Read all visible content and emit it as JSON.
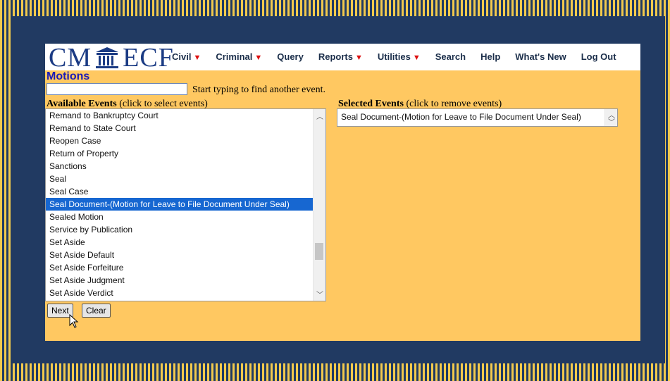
{
  "logo": {
    "left": "CM",
    "right": "ECF"
  },
  "nav": [
    {
      "label": "Civil",
      "dropdown": true
    },
    {
      "label": "Criminal",
      "dropdown": true
    },
    {
      "label": "Query",
      "dropdown": false
    },
    {
      "label": "Reports",
      "dropdown": true
    },
    {
      "label": "Utilities",
      "dropdown": true
    },
    {
      "label": "Search",
      "dropdown": false
    },
    {
      "label": "Help",
      "dropdown": false
    },
    {
      "label": "What's New",
      "dropdown": false
    },
    {
      "label": "Log Out",
      "dropdown": false
    }
  ],
  "page": {
    "title": "Motions",
    "search_value": "",
    "search_hint": "Start typing to find another event.",
    "available_label_bold": "Available Events",
    "available_label_rest": " (click to select events)",
    "selected_label_bold": "Selected Events",
    "selected_label_rest": " (click to remove events)"
  },
  "available_events": [
    "Remand to Bankruptcy Court",
    "Remand to State Court",
    "Reopen Case",
    "Return of Property",
    "Sanctions",
    "Seal",
    "Seal Case",
    "Seal Document-(Motion for Leave to File Document Under Seal)",
    "Sealed Motion",
    "Service by Publication",
    "Set Aside",
    "Set Aside Default",
    "Set Aside Forfeiture",
    "Set Aside Judgment",
    "Set Aside Verdict"
  ],
  "available_selected_index": 7,
  "selected_events": [
    "Seal Document-(Motion for Leave to File Document Under Seal)"
  ],
  "buttons": {
    "next": "Next",
    "clear": "Clear"
  },
  "colors": {
    "nav_border": "#1f3a63",
    "content_bg": "#ffc861",
    "selection": "#1767d1",
    "title": "#1b1bb6"
  }
}
